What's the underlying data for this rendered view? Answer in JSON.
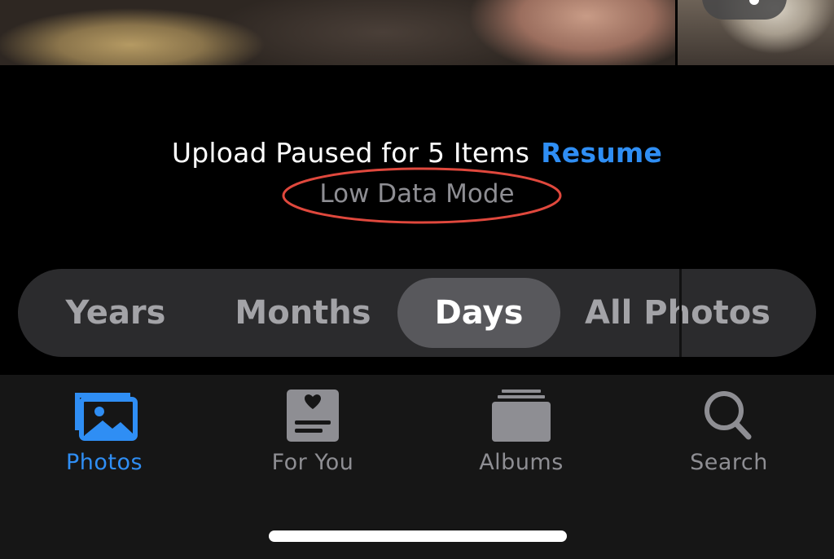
{
  "upload": {
    "message": "Upload Paused for 5 Items",
    "resume_label": "Resume",
    "mode_label": "Low Data Mode"
  },
  "segmented_control": {
    "segments": [
      "Years",
      "Months",
      "Days",
      "All Photos"
    ],
    "selected": "Days"
  },
  "tab_bar": {
    "tabs": [
      {
        "label": "Photos",
        "icon": "photos-icon",
        "active": true
      },
      {
        "label": "For You",
        "icon": "for-you-icon",
        "active": false
      },
      {
        "label": "Albums",
        "icon": "albums-icon",
        "active": false
      },
      {
        "label": "Search",
        "icon": "search-icon",
        "active": false
      }
    ]
  },
  "colors": {
    "accent": "#2f8ef4",
    "annotation": "#e0483d",
    "background": "#000000",
    "tab_bar": "#161616",
    "inactive": "#8e8e93"
  }
}
